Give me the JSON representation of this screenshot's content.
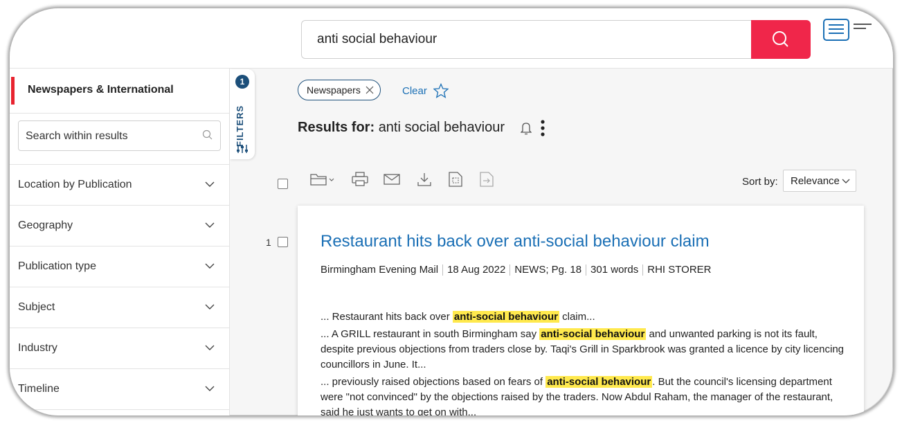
{
  "search": {
    "query": "anti social behaviour"
  },
  "sidebar": {
    "section_title": "Newspapers & International",
    "within_placeholder": "Search within results",
    "facets": [
      "Location by Publication",
      "Geography",
      "Publication type",
      "Subject",
      "Industry",
      "Timeline"
    ]
  },
  "filters_tab": {
    "label": "FILTERS",
    "count": "1"
  },
  "active_filter": {
    "chip_label": "Newspapers",
    "clear_label": "Clear"
  },
  "results": {
    "heading_prefix": "Results for:",
    "heading_query": "anti social behaviour"
  },
  "sort": {
    "label": "Sort by:",
    "value": "Relevance"
  },
  "result_1": {
    "number": "1",
    "title": "Restaurant hits back over anti-social behaviour claim",
    "meta": [
      "Birmingham Evening Mail",
      "18 Aug 2022",
      "NEWS; Pg. 18",
      "301 words",
      "RHI STORER"
    ],
    "snippets": [
      {
        "pre": "... Restaurant hits back over ",
        "hit": "anti-social behaviour",
        "post": " claim..."
      },
      {
        "pre": "... A GRILL restaurant in south Birmingham say ",
        "hit": "anti-social behaviour",
        "post": " and unwanted parking is not its fault, despite previous objections from traders close by. Taqi's Grill in Sparkbrook was granted a licence by city licencing councillors in June. It..."
      },
      {
        "pre": "... previously raised objections based on fears of ",
        "hit": "anti-social behaviour",
        "post": ". But the council's licensing department were \"not convinced\" by the objections raised by the traders. Now Abdul Raham, the manager of the restaurant, said he just wants to get on with..."
      }
    ]
  },
  "colors": {
    "accent_red": "#f0264a",
    "link_blue": "#1a6fb5",
    "highlight": "#ffe94d",
    "navy": "#1c4f7a"
  }
}
